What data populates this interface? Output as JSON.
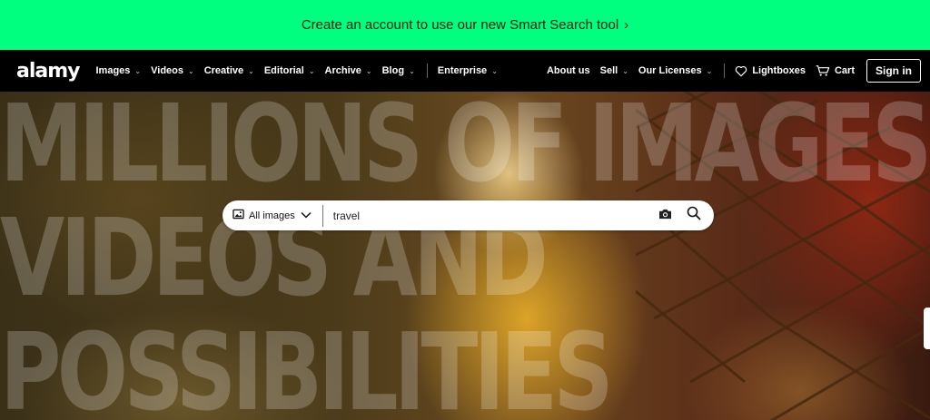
{
  "promo": {
    "text": "Create an account to use our new Smart Search tool",
    "chevron": "›"
  },
  "nav": {
    "logo": "alamy",
    "items": [
      {
        "label": "Images"
      },
      {
        "label": "Videos"
      },
      {
        "label": "Creative"
      },
      {
        "label": "Editorial"
      },
      {
        "label": "Archive"
      },
      {
        "label": "Blog"
      }
    ],
    "enterprise": "Enterprise",
    "about": "About us",
    "sell": "Sell",
    "licenses": "Our Licenses",
    "lightboxes": "Lightboxes",
    "cart": "Cart",
    "signin": "Sign in"
  },
  "hero": {
    "headline_lines": [
      "MILLIONS OF IMAGES,",
      "VIDEOS AND",
      "POSSIBILITIES"
    ]
  },
  "search": {
    "type_label": "All images",
    "value": "travel",
    "icons": [
      "image-icon",
      "chevron-down-icon",
      "camera-icon",
      "search-icon"
    ]
  },
  "colors": {
    "promo_bg": "#00ff7f",
    "nav_bg": "#000000",
    "search_bg": "#ffffff"
  }
}
